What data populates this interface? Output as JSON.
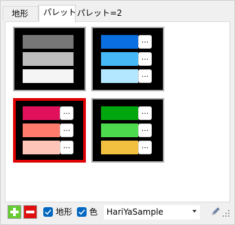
{
  "tabs": [
    {
      "label": "地形",
      "selected": false
    },
    {
      "label": "パレット",
      "selected": true
    },
    {
      "label": "パレット=2",
      "selected": false
    }
  ],
  "palettes": [
    {
      "selected": false,
      "has_buttons": false,
      "colors": [
        "#777777",
        "#bdbdbd",
        "#f5f5f5"
      ]
    },
    {
      "selected": false,
      "has_buttons": true,
      "colors": [
        "#0a6fe0",
        "#45b8f5",
        "#b3e6ff"
      ]
    },
    {
      "selected": true,
      "has_buttons": true,
      "colors": [
        "#e0105a",
        "#ff7b6b",
        "#ffc4b8"
      ]
    },
    {
      "selected": false,
      "has_buttons": true,
      "colors": [
        "#00a60d",
        "#4dd94d",
        "#f2c040"
      ]
    }
  ],
  "swatch_button_label": "...",
  "bottom": {
    "add_icon": "plus-icon",
    "remove_icon": "minus-icon",
    "terrain_check": {
      "label": "地形",
      "checked": true
    },
    "color_check": {
      "label": "色",
      "checked": true
    },
    "sample_select": {
      "value": "HariYaSample"
    },
    "edit_icon": "pencil-icon",
    "grip_icon": "resize-grip-icon"
  },
  "colors": {
    "accent": "#0067c0",
    "selection": "#e00000",
    "add": "#66cc33",
    "remove": "#e01010"
  }
}
